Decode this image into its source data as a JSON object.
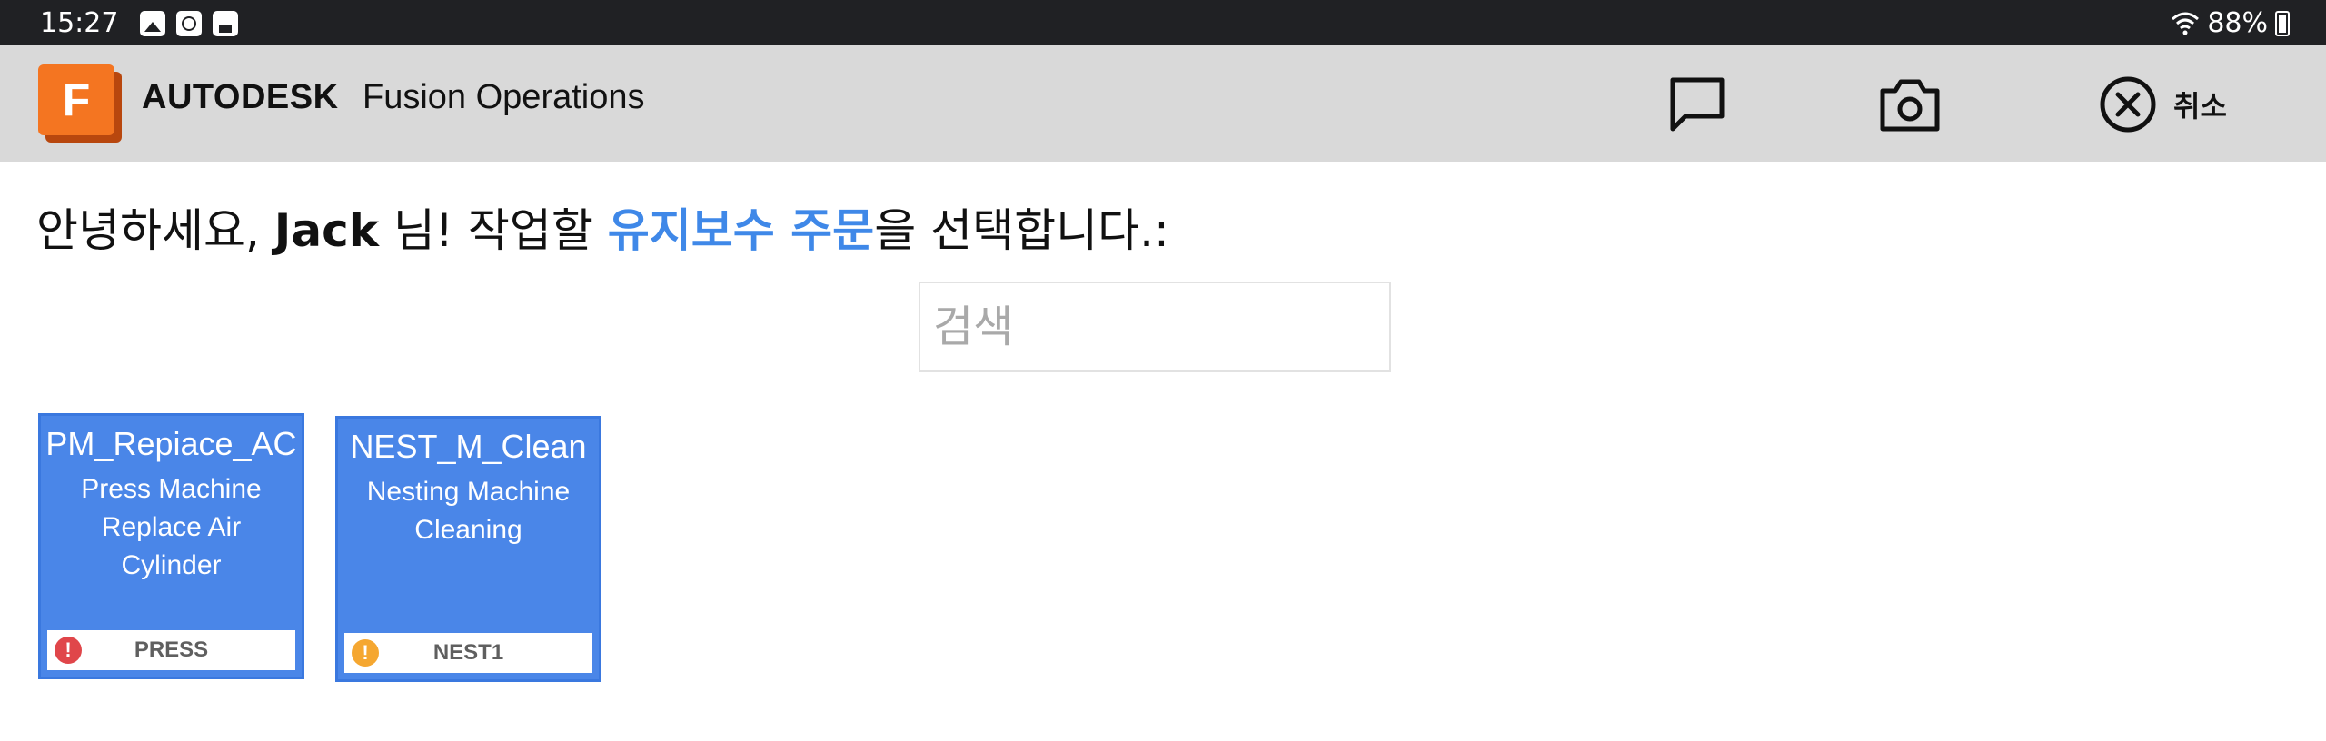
{
  "status_bar": {
    "time": "15:27",
    "notification_icons": [
      "image-icon",
      "clock-icon",
      "save-icon"
    ],
    "battery": "88%"
  },
  "header": {
    "logo_letter": "F",
    "brand": "AUTODESK",
    "product": "Fusion Operations",
    "cancel_label": "취소",
    "accent_color": "#f47521"
  },
  "greeting": {
    "prefix": "안녕하세요, ",
    "user": "Jack",
    "middle": " 님! 작업할 ",
    "highlight": "유지보수 주문",
    "suffix": "을 선택합니다.:",
    "highlight_color": "#3f88e8"
  },
  "search": {
    "placeholder": "검색",
    "value": ""
  },
  "orders": [
    {
      "code": "PM_Repiace_AC",
      "description": "Press Machine Replace Air Cylinder",
      "resource": "PRESS",
      "priority_icon": "alert-red-icon",
      "priority_color": "#e0464a"
    },
    {
      "code": "NEST_M_Clean",
      "description": "Nesting Machine Cleaning",
      "resource": "NEST1",
      "priority_icon": "alert-orange-icon",
      "priority_color": "#f5a731"
    }
  ],
  "card_color": "#4a86e8"
}
